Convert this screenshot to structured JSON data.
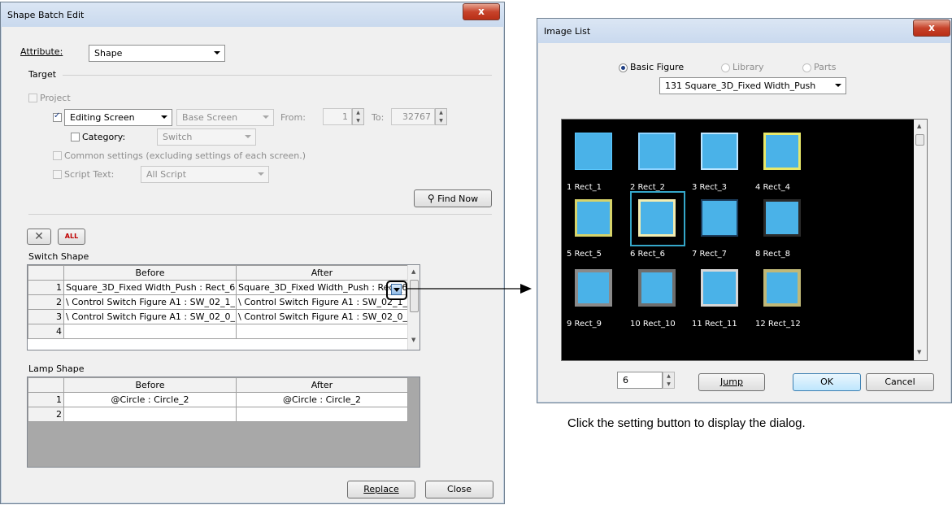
{
  "dialog": {
    "title": "Shape Batch Edit",
    "close_glyph": "x",
    "attribute_label": "Attribute:",
    "attribute_value": "Shape",
    "target_label": "Target",
    "project_label": "Project",
    "screen_type": "Editing Screen",
    "screen_kind": "Base Screen",
    "from_label": "From:",
    "from_value": "1",
    "to_label": "To:",
    "to_value": "32767",
    "category_label": "Category:",
    "category_value": "Switch",
    "common_settings_label": "Common settings (excluding settings of each screen.)",
    "script_label": "Script Text:",
    "script_value": "All Script",
    "find_now": "Find Now",
    "switch_shape_label": "Switch Shape",
    "lamp_shape_label": "Lamp Shape",
    "col_before": "Before",
    "col_after": "After",
    "switch_rows": [
      {
        "num": "1",
        "before": "Square_3D_Fixed Width_Push : Rect_6",
        "after": "Square_3D_Fixed Width_Push : Rect_6"
      },
      {
        "num": "2",
        "before": "\\ Control Switch Figure A1 : SW_02_1_",
        "after": "\\ Control Switch Figure A1 : SW_02_1_"
      },
      {
        "num": "3",
        "before": "\\ Control Switch Figure A1 : SW_02_0_",
        "after": "\\ Control Switch Figure A1 : SW_02_0_"
      },
      {
        "num": "4",
        "before": "",
        "after": ""
      }
    ],
    "lamp_rows": [
      {
        "num": "1",
        "before": "@Circle : Circle_2",
        "after": "@Circle : Circle_2"
      },
      {
        "num": "2",
        "before": "",
        "after": ""
      }
    ],
    "replace": "Replace",
    "close": "Close",
    "ell_glyph": "ALL"
  },
  "image_list": {
    "title": "Image List",
    "close_glyph": "x",
    "radio_basic": "Basic Figure",
    "radio_library": "Library",
    "radio_parts": "Parts",
    "figure_combo": "131 Square_3D_Fixed Width_Push",
    "tiles": [
      {
        "label": "1 Rect_1"
      },
      {
        "label": "2 Rect_2"
      },
      {
        "label": "3 Rect_3"
      },
      {
        "label": "4 Rect_4"
      },
      {
        "label": "5 Rect_5"
      },
      {
        "label": "6 Rect_6"
      },
      {
        "label": "7 Rect_7"
      },
      {
        "label": "8 Rect_8"
      },
      {
        "label": "9 Rect_9"
      },
      {
        "label": "10 Rect_10"
      },
      {
        "label": "11 Rect_11"
      },
      {
        "label": "12 Rect_12"
      }
    ],
    "jump_value": "6",
    "jump": "Jump",
    "ok": "OK",
    "cancel": "Cancel"
  },
  "caption": "Click the setting button to display the dialog.",
  "colors": {
    "tile_fill": "#4ab2e8",
    "accent": "#3c7fb1"
  }
}
